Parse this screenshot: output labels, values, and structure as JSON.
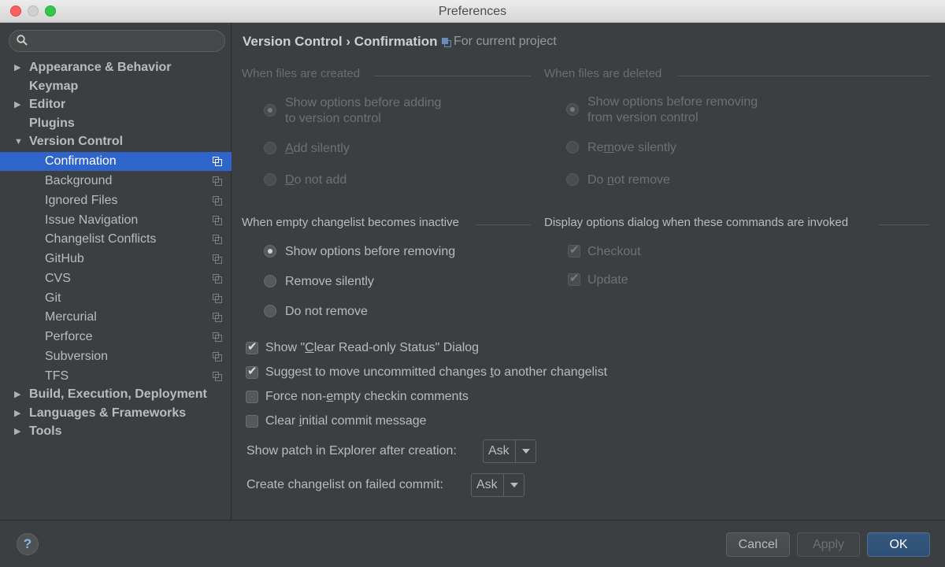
{
  "window": {
    "title": "Preferences"
  },
  "sidebar": {
    "search_placeholder": "",
    "items": [
      {
        "label": "Appearance & Behavior"
      },
      {
        "label": "Keymap"
      },
      {
        "label": "Editor"
      },
      {
        "label": "Plugins"
      },
      {
        "label": "Version Control"
      },
      {
        "label": "Confirmation"
      },
      {
        "label": "Background"
      },
      {
        "label": "Ignored Files"
      },
      {
        "label": "Issue Navigation"
      },
      {
        "label": "Changelist Conflicts"
      },
      {
        "label": "GitHub"
      },
      {
        "label": "CVS"
      },
      {
        "label": "Git"
      },
      {
        "label": "Mercurial"
      },
      {
        "label": "Perforce"
      },
      {
        "label": "Subversion"
      },
      {
        "label": "TFS"
      },
      {
        "label": "Build, Execution, Deployment"
      },
      {
        "label": "Languages & Frameworks"
      },
      {
        "label": "Tools"
      }
    ]
  },
  "header": {
    "section": "Version Control",
    "separator": "›",
    "page": "Confirmation",
    "scope": "For current project"
  },
  "files_created": {
    "title": "When files are created",
    "opt1_line1": "Show options before adding",
    "opt1_line2": "to version control",
    "opt2_u": "A",
    "opt2_rest": "dd silently",
    "opt3_u": "D",
    "opt3_rest": "o not add"
  },
  "files_deleted": {
    "title": "When files are deleted",
    "opt1_line1": "Show options before removing",
    "opt1_line2": "from version control",
    "opt2_pre": "Re",
    "opt2_u": "m",
    "opt2_rest": "ove silently",
    "opt3_pre": "Do ",
    "opt3_u": "n",
    "opt3_rest": "ot remove"
  },
  "empty_changelist": {
    "title": "When empty changelist becomes inactive",
    "opt1": "Show options before removing",
    "opt2": "Remove silently",
    "opt3": "Do not remove"
  },
  "display_options": {
    "title": "Display options dialog when these commands are invoked",
    "opt1": "Checkout",
    "opt2": "Update"
  },
  "checkboxes": {
    "c1_pre": "Show \"",
    "c1_u": "C",
    "c1_rest": "lear Read-only Status\" Dialog",
    "c2_pre": "Suggest to move uncommitted changes ",
    "c2_u": "t",
    "c2_rest": "o another changelist",
    "c3_pre": "Force non-",
    "c3_u": "e",
    "c3_rest": "mpty checkin comments",
    "c4_pre": "Clear ",
    "c4_u": "i",
    "c4_rest": "nitial commit message"
  },
  "patch": {
    "label": "Show patch in Explorer after creation:",
    "value": "Ask"
  },
  "failed_commit": {
    "label": "Create changelist on failed commit:",
    "value": "Ask"
  },
  "footer": {
    "help": "?",
    "cancel": "Cancel",
    "apply": "Apply",
    "ok": "OK"
  }
}
